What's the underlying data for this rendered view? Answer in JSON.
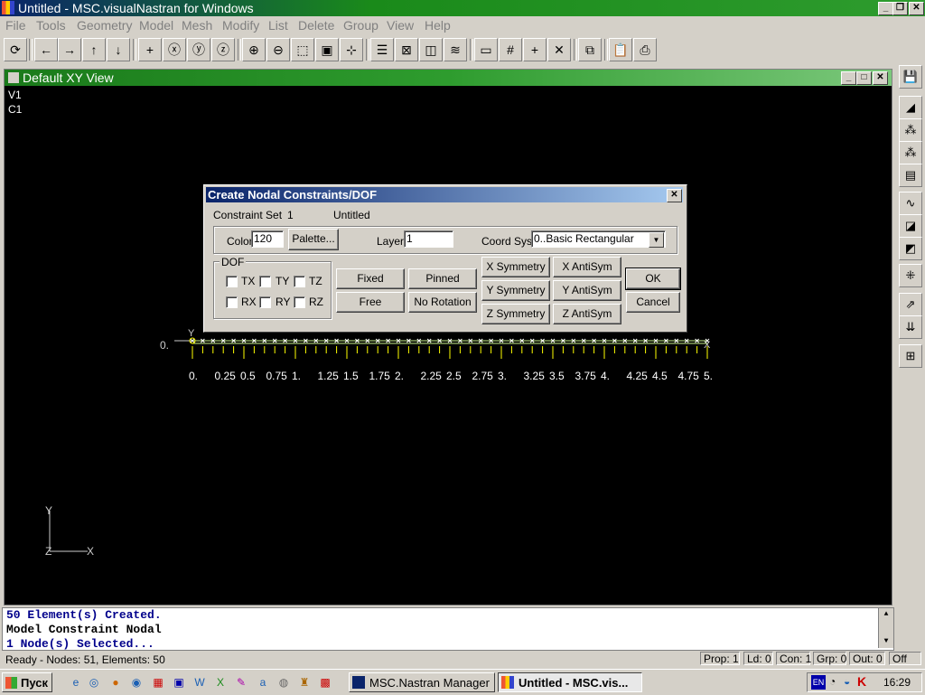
{
  "window": {
    "title": "Untitled - MSC.visualNastran for Windows"
  },
  "menu": [
    "File",
    "Tools",
    "Geometry",
    "Model",
    "Mesh",
    "Modify",
    "List",
    "Delete",
    "Group",
    "View",
    "Help"
  ],
  "view": {
    "title": "Default XY View",
    "corner_labels": [
      "V1",
      "C1"
    ]
  },
  "axis_triad": {
    "y": "Y",
    "x": "X",
    "z": "Z"
  },
  "model": {
    "origin_label": "0.",
    "y_marker": "Y",
    "x_marker": "X",
    "ticks": [
      "0.",
      "0.25",
      "0.5",
      "0.75",
      "1.",
      "1.25",
      "1.5",
      "1.75",
      "2.",
      "2.25",
      "2.5",
      "2.75",
      "3.",
      "3.25",
      "3.5",
      "3.75",
      "4.",
      "4.25",
      "4.5",
      "4.75",
      "5."
    ]
  },
  "dialog": {
    "title": "Create Nodal Constraints/DOF",
    "constraint_set_label": "Constraint Set",
    "constraint_set_id": "1",
    "constraint_set_name": "Untitled",
    "color_label": "Color",
    "color_value": "120",
    "palette_button": "Palette...",
    "layer_label": "Layer",
    "layer_value": "1",
    "coord_sys_label": "Coord Sys",
    "coord_sys_value": "0..Basic Rectangular",
    "dof_group": "DOF",
    "dof": [
      "TX",
      "TY",
      "TZ",
      "RX",
      "RY",
      "RZ"
    ],
    "buttons": {
      "fixed": "Fixed",
      "pinned": "Pinned",
      "free": "Free",
      "no_rotation": "No Rotation",
      "x_sym": "X Symmetry",
      "x_anti": "X AntiSym",
      "y_sym": "Y Symmetry",
      "y_anti": "Y AntiSym",
      "z_sym": "Z Symmetry",
      "z_anti": "Z AntiSym",
      "ok": "OK",
      "cancel": "Cancel"
    }
  },
  "console": [
    "50 Element(s) Created.",
    "Model Constraint Nodal",
    "1 Node(s) Selected..."
  ],
  "status": {
    "ready": "Ready - Nodes: 51,  Elements: 50",
    "prop": "Prop: 1",
    "ld": "Ld: 0",
    "con": "Con: 1",
    "grp": "Grp: 0",
    "out": "Out: 0",
    "off": "Off"
  },
  "taskbar": {
    "start": "Пуск",
    "tasks": [
      "MSC.Nastran Manager",
      "Untitled - MSC.vis..."
    ],
    "clock": "16:29",
    "lang": "EN"
  }
}
